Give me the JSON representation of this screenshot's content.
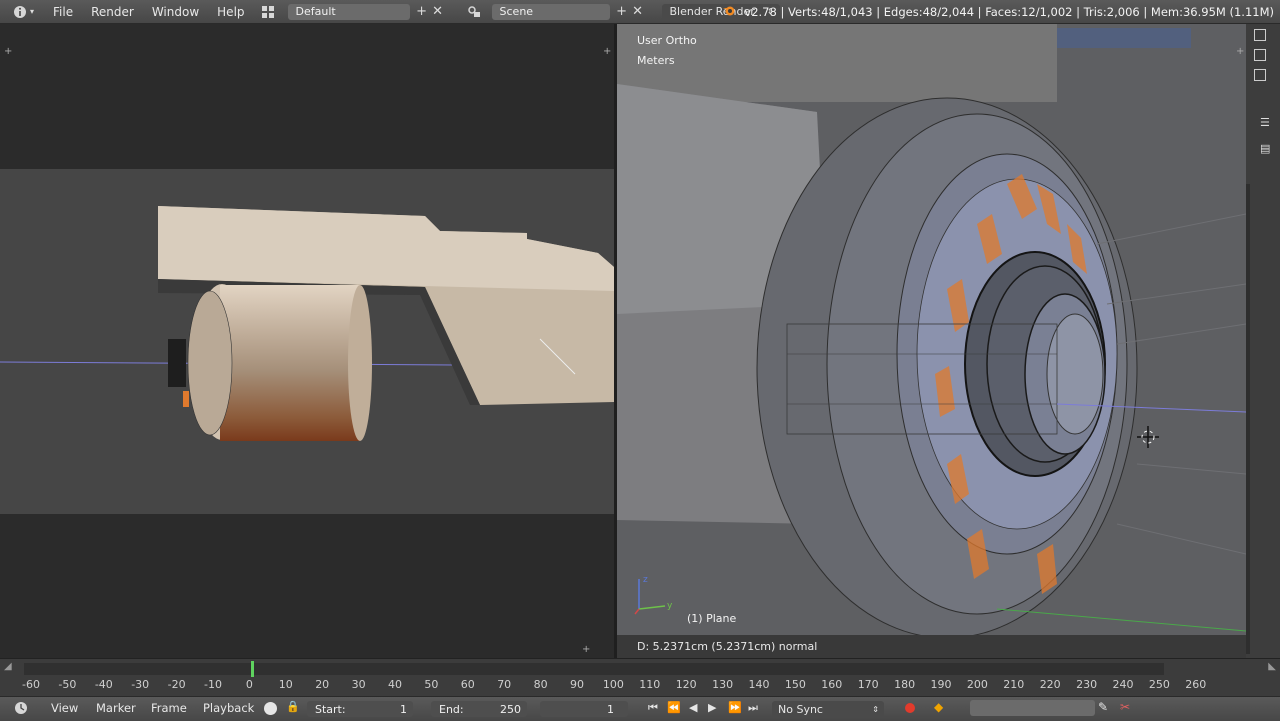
{
  "menubar": {
    "info_icon": "info-icon",
    "menus": [
      "File",
      "Render",
      "Window",
      "Help"
    ],
    "screen_layout": "Default",
    "scene": "Scene",
    "render_engine": "Blender Render",
    "stats": "v2.78 | Verts:48/1,043 | Edges:48/2,044 | Faces:12/1,002 | Tris:2,006 | Mem:36.95M (1.11M)"
  },
  "viewport_right": {
    "view_name": "User Ortho",
    "units": "Meters",
    "object_label": "(1) Plane",
    "operator_status": "D: 5.2371cm (5.2371cm) normal",
    "axis_colors": {
      "x": "#d24848",
      "y": "#6ec24a",
      "z": "#5a78d8"
    }
  },
  "timeline": {
    "ticks": [
      "-60",
      "-50",
      "-40",
      "-30",
      "-20",
      "-10",
      "0",
      "10",
      "20",
      "30",
      "40",
      "50",
      "60",
      "70",
      "80",
      "90",
      "100",
      "110",
      "120",
      "130",
      "140",
      "150",
      "160",
      "170",
      "180",
      "190",
      "200",
      "210",
      "220",
      "230",
      "240",
      "250",
      "260"
    ],
    "current_frame_marker_color": "#5fd35f"
  },
  "bottombar": {
    "view_label": "View",
    "marker_label": "Marker",
    "frame_label": "Frame",
    "playback_label": "Playback",
    "start_label": "Start:",
    "start_value": "1",
    "end_label": "End:",
    "end_value": "250",
    "current_frame": "1",
    "sync": "No Sync"
  },
  "colors": {
    "accent_selection": "#e07a2e",
    "record": "#e23b2c",
    "keyframe": "#f0a400"
  }
}
